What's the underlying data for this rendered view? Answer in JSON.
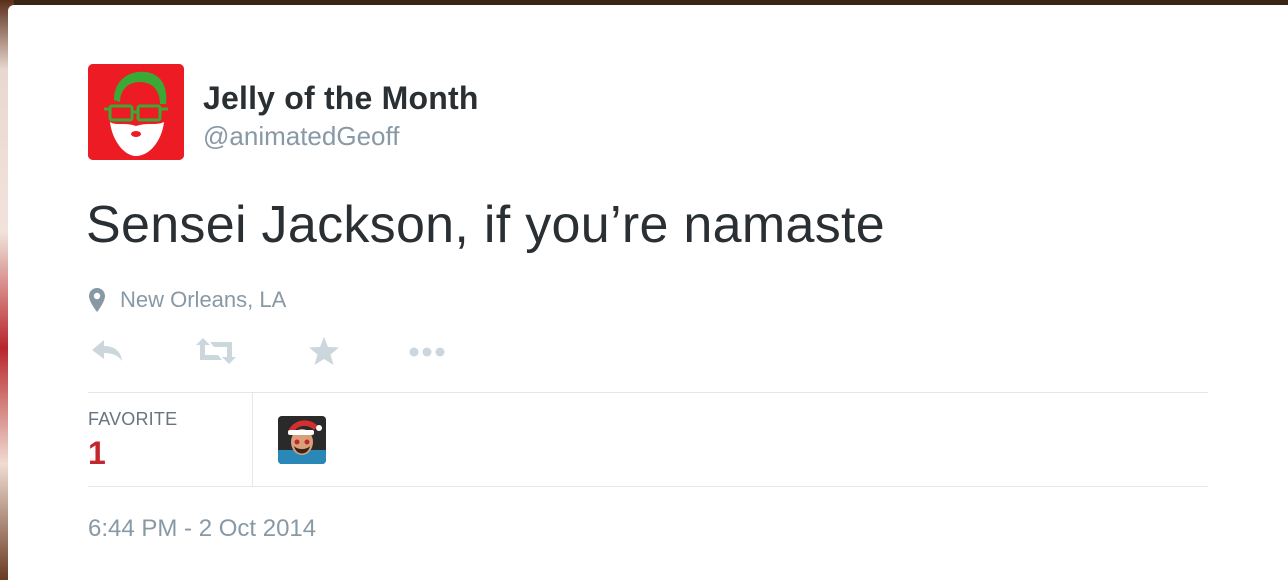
{
  "user": {
    "display_name": "Jelly of the Month",
    "handle": "@animatedGeoff",
    "avatar_icon": "santa-glasses-avatar"
  },
  "tweet": {
    "text": "Sensei Jackson, if you’re namaste",
    "location": "New Orleans, LA",
    "timestamp": "6:44 PM - 2 Oct 2014"
  },
  "actions": [
    "reply-icon",
    "retweet-icon",
    "favorite-icon",
    "more-icon"
  ],
  "stats": {
    "favorites_label": "FAVORITE",
    "favorites_count": "1"
  },
  "colors": {
    "avatar_bg": "#ed1c24",
    "text_primary": "#292f33",
    "text_secondary": "#8899a6",
    "favorite_count": "#c2272d",
    "icon_muted": "#ccd6dd"
  }
}
